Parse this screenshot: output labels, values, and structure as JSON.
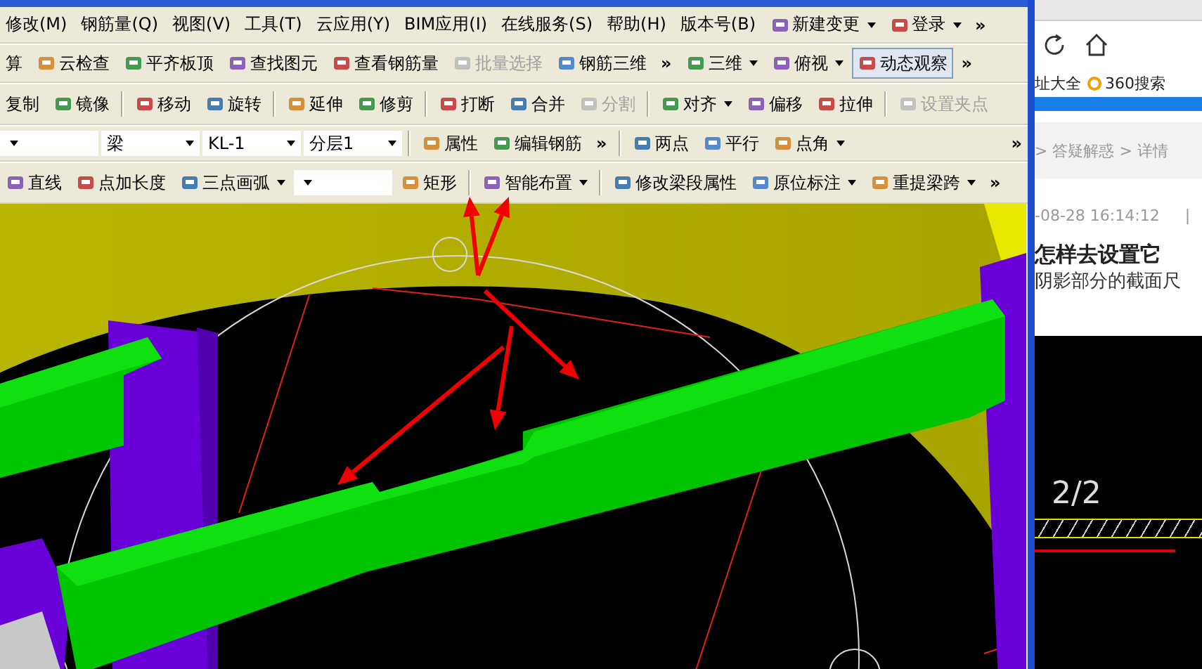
{
  "menu": {
    "items": [
      "修改(M)",
      "钢筋量(Q)",
      "视图(V)",
      "工具(T)",
      "云应用(Y)",
      "BIM应用(I)",
      "在线服务(S)",
      "帮助(H)",
      "版本号(B)"
    ],
    "extras": [
      {
        "kind": "dropdown",
        "label": "新建变更",
        "disabled": false,
        "pressed": false
      },
      {
        "kind": "dropdown",
        "label": "登录",
        "disabled": false,
        "pressed": false
      },
      {
        "kind": "more",
        "label": "»"
      }
    ]
  },
  "toolbars": [
    {
      "items": [
        {
          "kind": "textbutton",
          "label": "算",
          "disabled": false,
          "pressed": false
        },
        {
          "kind": "button",
          "label": "云检查",
          "disabled": false,
          "pressed": false
        },
        {
          "kind": "button",
          "label": "平齐板顶",
          "disabled": false,
          "pressed": false
        },
        {
          "kind": "button",
          "label": "查找图元",
          "disabled": false,
          "pressed": false
        },
        {
          "kind": "button",
          "label": "查看钢筋量",
          "disabled": false,
          "pressed": false
        },
        {
          "kind": "button",
          "label": "批量选择",
          "disabled": true,
          "pressed": false
        },
        {
          "kind": "button",
          "label": "钢筋三维",
          "disabled": false,
          "pressed": false
        },
        {
          "kind": "more",
          "label": "»"
        },
        {
          "kind": "dropdown",
          "label": "三维",
          "disabled": false,
          "pressed": false
        },
        {
          "kind": "dropdown",
          "label": "俯视",
          "disabled": false,
          "pressed": false
        },
        {
          "kind": "button",
          "label": "动态观察",
          "disabled": false,
          "pressed": true
        },
        {
          "kind": "more",
          "label": "»"
        }
      ]
    },
    {
      "items": [
        {
          "kind": "textbutton",
          "label": "复制",
          "disabled": false,
          "pressed": false
        },
        {
          "kind": "button",
          "label": "镜像",
          "disabled": false,
          "pressed": false
        },
        {
          "kind": "separator"
        },
        {
          "kind": "button",
          "label": "移动",
          "disabled": false,
          "pressed": false
        },
        {
          "kind": "button",
          "label": "旋转",
          "disabled": false,
          "pressed": false
        },
        {
          "kind": "separator"
        },
        {
          "kind": "button",
          "label": "延伸",
          "disabled": false,
          "pressed": false
        },
        {
          "kind": "button",
          "label": "修剪",
          "disabled": false,
          "pressed": false
        },
        {
          "kind": "separator"
        },
        {
          "kind": "button",
          "label": "打断",
          "disabled": false,
          "pressed": false
        },
        {
          "kind": "button",
          "label": "合并",
          "disabled": false,
          "pressed": false
        },
        {
          "kind": "button",
          "label": "分割",
          "disabled": true,
          "pressed": false
        },
        {
          "kind": "separator"
        },
        {
          "kind": "dropdown",
          "label": "对齐",
          "disabled": false,
          "pressed": false
        },
        {
          "kind": "button",
          "label": "偏移",
          "disabled": false,
          "pressed": false
        },
        {
          "kind": "button",
          "label": "拉伸",
          "disabled": false,
          "pressed": false
        },
        {
          "kind": "separator"
        },
        {
          "kind": "button",
          "label": "设置夹点",
          "disabled": true,
          "pressed": false
        }
      ]
    },
    {
      "items": [
        {
          "kind": "combo"
        },
        {
          "kind": "combo",
          "value": "梁"
        },
        {
          "kind": "combo",
          "value": "KL-1"
        },
        {
          "kind": "combo",
          "value": "分层1"
        },
        {
          "kind": "separator"
        },
        {
          "kind": "button",
          "label": "属性",
          "disabled": false,
          "pressed": false
        },
        {
          "kind": "button",
          "label": "编辑钢筋",
          "disabled": false,
          "pressed": false
        },
        {
          "kind": "more",
          "label": "»"
        },
        {
          "kind": "separator"
        },
        {
          "kind": "button",
          "label": "两点",
          "disabled": false,
          "pressed": false
        },
        {
          "kind": "button",
          "label": "平行",
          "disabled": false,
          "pressed": false
        },
        {
          "kind": "dropdown",
          "label": "点角",
          "disabled": false,
          "pressed": false
        },
        {
          "kind": "spacer"
        },
        {
          "kind": "more",
          "label": "»"
        }
      ]
    },
    {
      "items": [
        {
          "kind": "button",
          "label": "直线",
          "disabled": false,
          "pressed": false
        },
        {
          "kind": "button",
          "label": "点加长度",
          "disabled": false,
          "pressed": false
        },
        {
          "kind": "dropdown",
          "label": "三点画弧",
          "disabled": false,
          "pressed": false
        },
        {
          "kind": "combo"
        },
        {
          "kind": "button",
          "label": "矩形",
          "disabled": false,
          "pressed": false
        },
        {
          "kind": "separator"
        },
        {
          "kind": "dropdown",
          "label": "智能布置",
          "disabled": false,
          "pressed": false
        },
        {
          "kind": "separator"
        },
        {
          "kind": "button",
          "label": "修改梁段属性",
          "disabled": false,
          "pressed": false
        },
        {
          "kind": "dropdown",
          "label": "原位标注",
          "disabled": false,
          "pressed": false
        },
        {
          "kind": "dropdown",
          "label": "重提梁跨",
          "disabled": false,
          "pressed": false
        },
        {
          "kind": "more",
          "label": "»"
        }
      ]
    }
  ],
  "browser": {
    "bookmarks": [
      "址大全",
      "360搜索"
    ],
    "breadcrumb": "> 答疑解惑 > 详情",
    "date": "-08-28 16:14:12",
    "divider": "|",
    "title": "怎样去设置它",
    "body": "阴影部分的截面尺",
    "image_text": "2/2"
  }
}
